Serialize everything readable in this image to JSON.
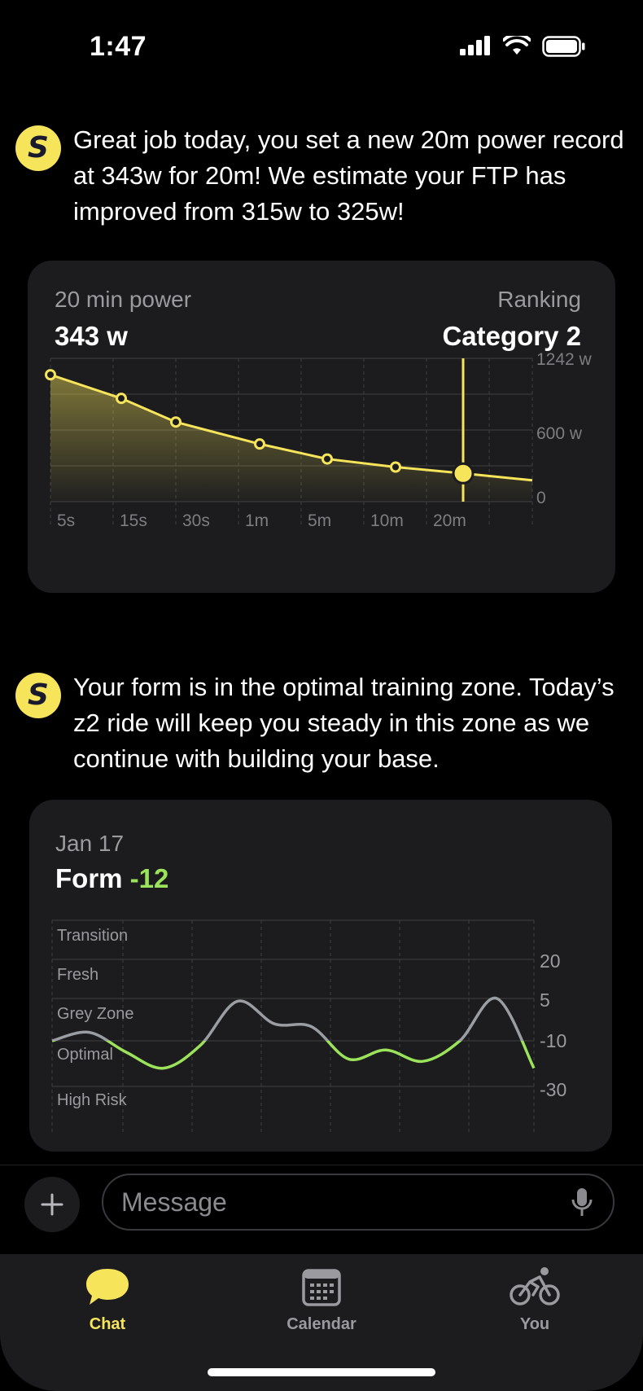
{
  "status_bar": {
    "time": "1:47"
  },
  "messages": [
    {
      "avatar_letter": "S",
      "text": "Great job today, you set a new 20m power record at 343w for 20m! We estimate your FTP has improved from 315w to 325w!"
    },
    {
      "avatar_letter": "S",
      "text": "Your form is in the optimal training zone. Today’s z2 ride will keep you steady in this zone as we continue with building your base."
    }
  ],
  "power_card": {
    "metric_label": "20 min power",
    "metric_value": "343 w",
    "ranking_label": "Ranking",
    "ranking_value": "Category 2"
  },
  "form_card": {
    "date": "Jan 17",
    "form_label": "Form",
    "form_value": "-12"
  },
  "chart_data": [
    {
      "type": "area",
      "categories": [
        "5s",
        "15s",
        "30s",
        "1m",
        "5m",
        "10m",
        "20m"
      ],
      "x": [
        "5s",
        "15s",
        "30s",
        "1m",
        "5m",
        "10m",
        "20m",
        "end"
      ],
      "values": [
        1100,
        895,
        690,
        500,
        370,
        300,
        245,
        185
      ],
      "highlight": {
        "x": "20m",
        "value": 245
      },
      "y_ticks": [
        "1242 w",
        "600 w",
        "0"
      ],
      "ylim": [
        0,
        1242
      ],
      "color": "#f6e45a",
      "grid": true
    },
    {
      "type": "line",
      "zones": [
        "Transition",
        "Fresh",
        "Grey Zone",
        "Optimal",
        "High Risk"
      ],
      "y_ticks": [
        "20",
        "5",
        "-10",
        "-30"
      ],
      "values": [
        -10,
        -7,
        -15,
        -22,
        -12,
        4,
        -4,
        -5,
        -18,
        -14,
        -19,
        -10,
        5,
        -22
      ],
      "colors": {
        "grey_zone": "#9a9ea3",
        "optimal": "#9be35a"
      },
      "grid": true
    }
  ],
  "composer": {
    "placeholder": "Message"
  },
  "tabs": [
    {
      "label": "Chat",
      "icon": "chat-bubble-icon",
      "active": true
    },
    {
      "label": "Calendar",
      "icon": "calendar-icon",
      "active": false
    },
    {
      "label": "You",
      "icon": "cyclist-icon",
      "active": false
    }
  ],
  "colors": {
    "accent": "#f6e45a",
    "green": "#9be35a",
    "card": "#1c1c1e"
  }
}
